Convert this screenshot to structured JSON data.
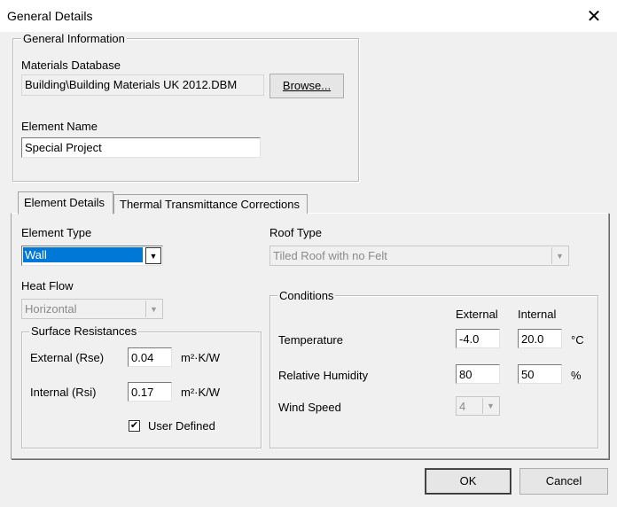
{
  "window": {
    "title": "General Details",
    "close_glyph": "✕"
  },
  "general_info": {
    "legend": "General Information",
    "materials_db_label": "Materials Database",
    "materials_db_value": "Building\\Building Materials UK 2012.DBM",
    "browse_label": "Browse...",
    "element_name_label": "Element Name",
    "element_name_value": "Special Project"
  },
  "tabs": [
    {
      "label": "Element Details",
      "active": true
    },
    {
      "label": "Thermal Transmittance Corrections",
      "active": false
    }
  ],
  "element_details": {
    "element_type_label": "Element Type",
    "element_type_value": "Wall",
    "roof_type_label": "Roof Type",
    "roof_type_value": "Tiled Roof with no Felt",
    "heat_flow_label": "Heat Flow",
    "heat_flow_value": "Horizontal",
    "surface_resistances": {
      "legend": "Surface Resistances",
      "external_label": "External (Rse)",
      "external_value": "0.04",
      "internal_label": "Internal (Rsi)",
      "internal_value": "0.17",
      "unit": "m²·K/W",
      "user_defined_label": "User Defined",
      "user_defined_checked": true
    },
    "conditions": {
      "legend": "Conditions",
      "col_external": "External",
      "col_internal": "Internal",
      "temperature_label": "Temperature",
      "temperature_external": "-4.0",
      "temperature_internal": "20.0",
      "temperature_unit": "°C",
      "humidity_label": "Relative Humidity",
      "humidity_external": "80",
      "humidity_internal": "50",
      "humidity_unit": "%",
      "wind_label": "Wind Speed",
      "wind_value": "4"
    }
  },
  "footer": {
    "ok_label": "OK",
    "cancel_label": "Cancel"
  },
  "colors": {
    "selection": "#0078d7",
    "window_bg": "#f0f0f0",
    "titlebar_bg": "#ffffff"
  }
}
